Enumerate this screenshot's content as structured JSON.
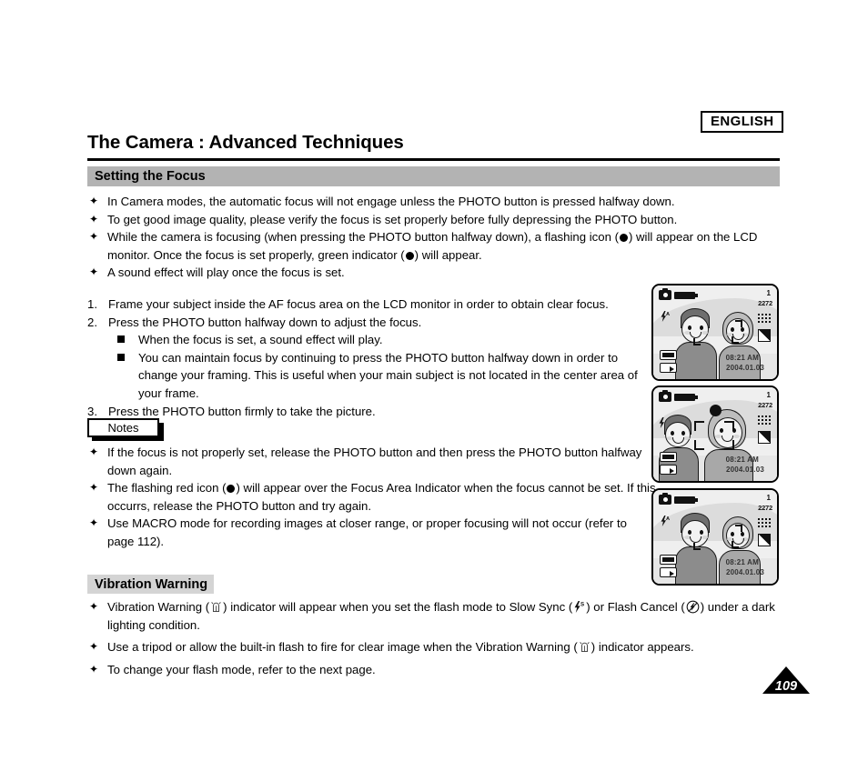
{
  "header": {
    "language_badge": "ENGLISH",
    "title": "The Camera : Advanced Techniques"
  },
  "sections": [
    {
      "id": "setting-the-focus",
      "heading": "Setting the Focus",
      "bullets": [
        "In Camera modes, the automatic focus will not engage unless the PHOTO button is pressed halfway down.",
        "To get good image quality, please verify the focus is set properly before fully depressing the PHOTO button.",
        "While the camera is focusing (when pressing the PHOTO button halfway down), a flashing icon (",
        "A sound effect will play once the focus is set."
      ],
      "bullet3_part2": ") will appear on the LCD monitor. Once the focus is set properly, green indicator (",
      "bullet3_part3": ") will appear.",
      "steps": [
        {
          "num": "1.",
          "text": "Frame your subject inside the AF focus area on the LCD monitor in order to obtain clear focus."
        },
        {
          "num": "2.",
          "text": "Press the PHOTO button halfway down to adjust the focus."
        },
        {
          "num": "3.",
          "text": "Press the PHOTO button firmly to take the picture."
        }
      ],
      "substeps": [
        "When the focus is set, a sound effect will play.",
        "You can maintain focus by continuing to press the PHOTO button halfway down in order to change your framing. This is useful when your main subject is not located in the center area of your frame."
      ]
    },
    {
      "id": "notes",
      "heading": "Notes",
      "bullets": [
        "If the focus is not properly set, release the PHOTO button and then press the PHOTO button halfway down again.",
        "The flashing red icon (",
        "Use MACRO mode for recording images at closer range, or proper focusing will not occur (refer to page 112)."
      ],
      "bullet2_part2": ")  will appear over the Focus Area Indicator when the focus cannot be set. If this occurrs, release the PHOTO button and try again."
    },
    {
      "id": "vibration-warning",
      "heading": "Vibration Warning",
      "bullet1_part1": "Vibration Warning (",
      "bullet1_part2": ") indicator will appear when you set the flash mode to Slow Sync (",
      "bullet1_part3": ") or Flash Cancel (",
      "bullet1_part4": ") under a dark lighting condition.",
      "bullet2_part1": "Use a tripod or allow the built-in flash to fire for clear image when the Vibration Warning (",
      "bullet2_part2": ") indicator appears.",
      "bullet3": "To change your flash mode, refer to the next page."
    }
  ],
  "lcd_screens": [
    {
      "label": "lcd-screen-1",
      "shots_remaining": "1",
      "resolution": "2272",
      "time": "08:21 AM",
      "date": "2004.01.03",
      "flash_mode_icon": "flash-auto-icon",
      "focus_state": "small-focus-corners"
    },
    {
      "label": "lcd-screen-2",
      "shots_remaining": "1",
      "resolution": "2272",
      "time": "08:21 AM",
      "date": "2004.01.03",
      "flash_mode_icon": "flash-auto-icon",
      "focus_state": "af-area-brackets-with-indicator"
    },
    {
      "label": "lcd-screen-3",
      "shots_remaining": "1",
      "resolution": "2272",
      "time": "08:21 AM",
      "date": "2004.01.03",
      "flash_mode_icon": "flash-auto-icon",
      "focus_state": "small-focus-corners"
    }
  ],
  "footer": {
    "page_number": "109"
  },
  "colors": {
    "section_bar": "#b3b3b3",
    "section_bar_light": "#d4d4d4",
    "text": "#000000",
    "page_background": "#ffffff"
  }
}
